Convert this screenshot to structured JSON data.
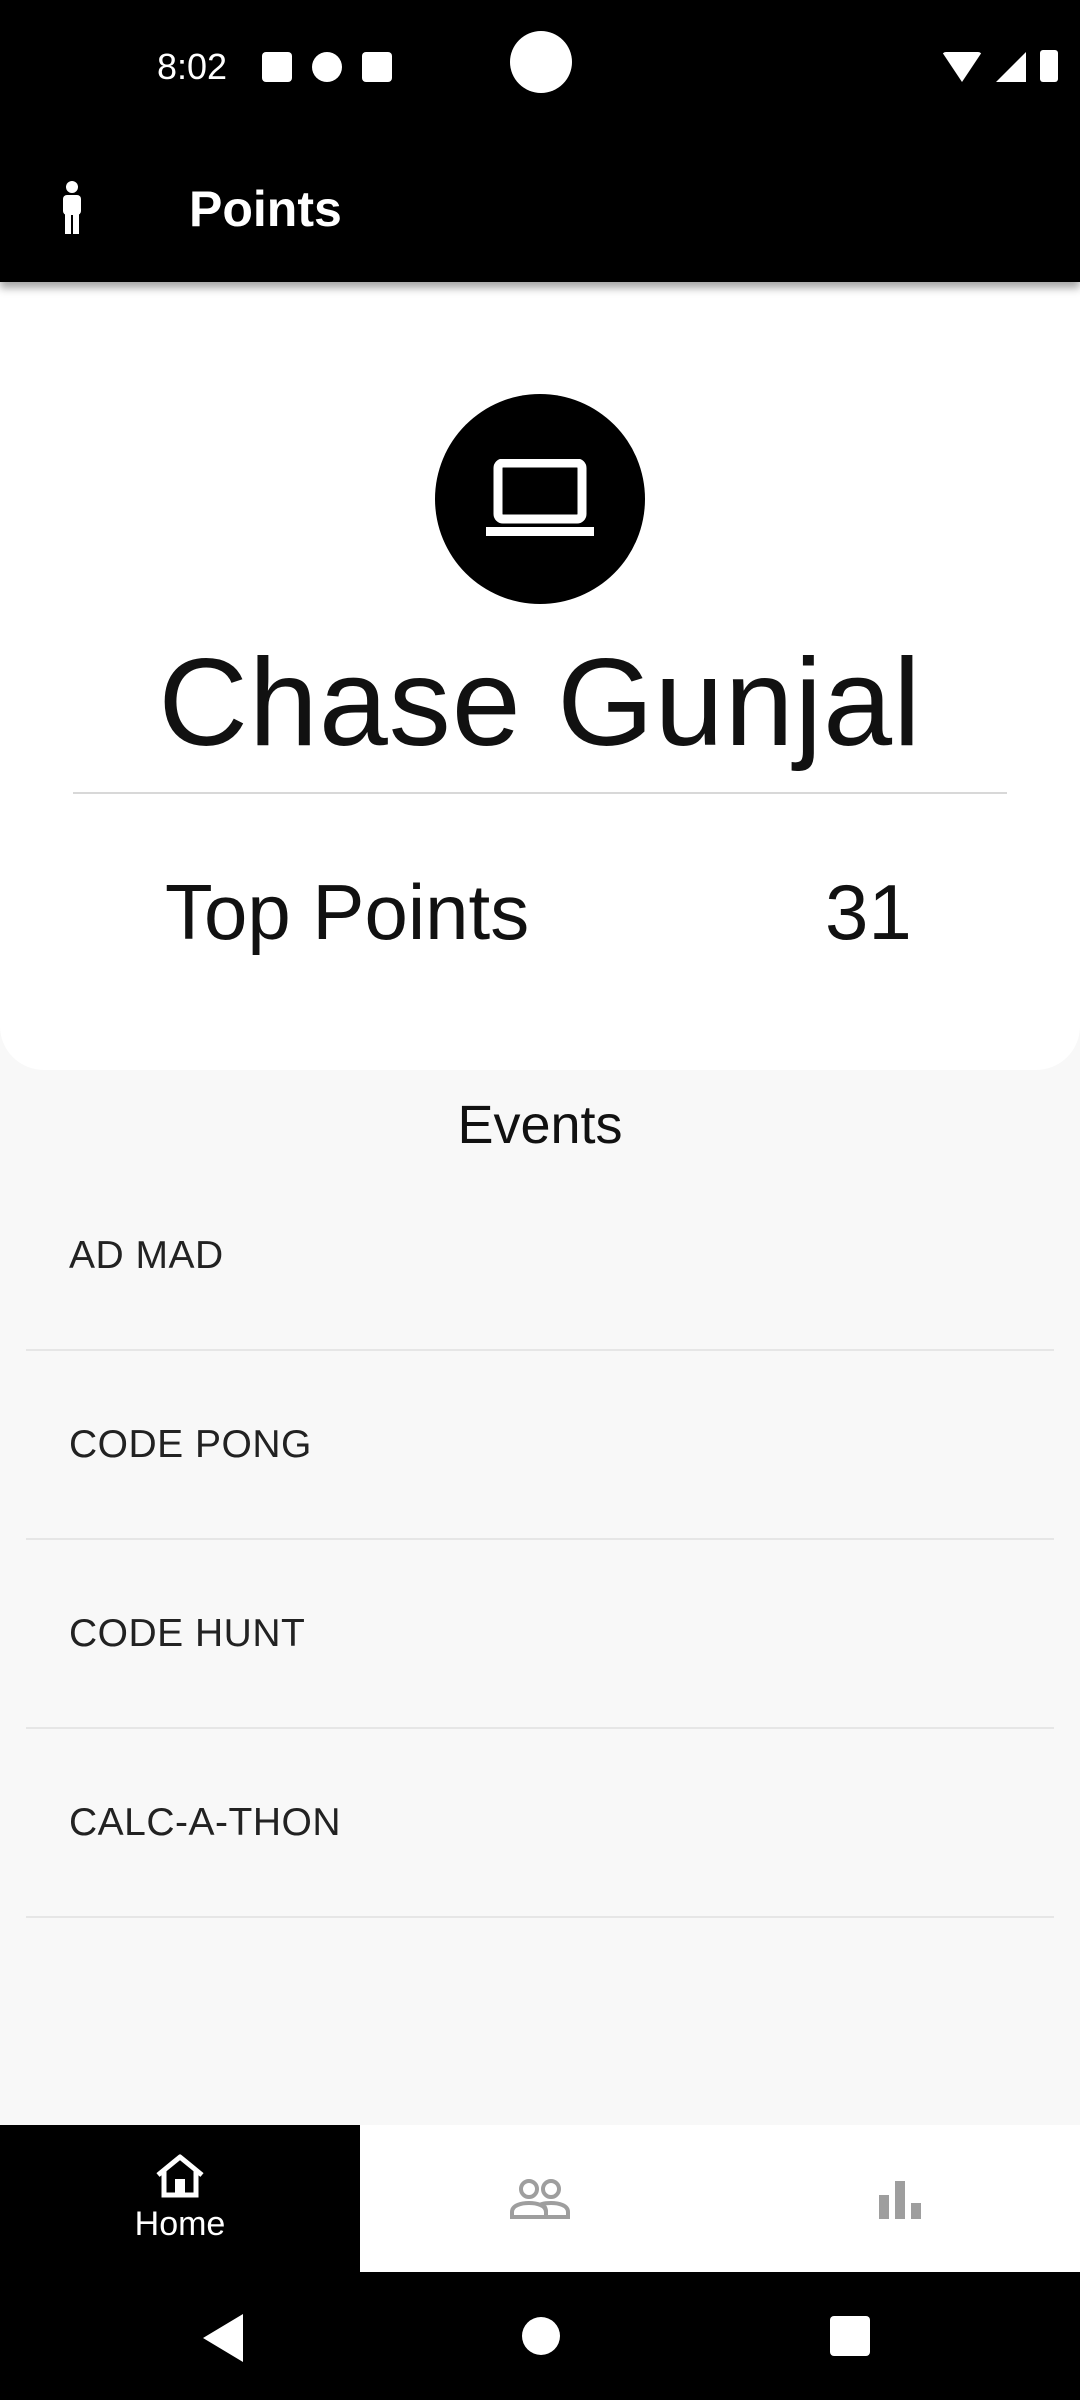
{
  "status_bar": {
    "time": "8:02",
    "icons": [
      "keyboard-a-icon",
      "privacy-dot-icon",
      "sd-card-icon",
      "wifi-icon",
      "signal-icon",
      "battery-icon"
    ]
  },
  "app_bar": {
    "title": "Points",
    "icon": "person-icon"
  },
  "profile": {
    "avatar_icon": "laptop-icon",
    "name": "Chase Gunjal",
    "stat_label": "Top Points",
    "stat_value": "31"
  },
  "events": {
    "title": "Events",
    "items": [
      {
        "label": "AD MAD"
      },
      {
        "label": "CODE PONG"
      },
      {
        "label": "CODE HUNT"
      },
      {
        "label": "CALC-A-THON"
      }
    ]
  },
  "bottom_nav": {
    "items": [
      {
        "label": "Home",
        "icon": "home-icon",
        "active": true
      },
      {
        "label": "",
        "icon": "people-icon",
        "active": false
      },
      {
        "label": "",
        "icon": "bar-chart-icon",
        "active": false
      }
    ]
  },
  "colors": {
    "primary": "#000000",
    "surface": "#ffffff",
    "background": "#f8f8f8",
    "inactive_icon": "#9e9e9e"
  }
}
